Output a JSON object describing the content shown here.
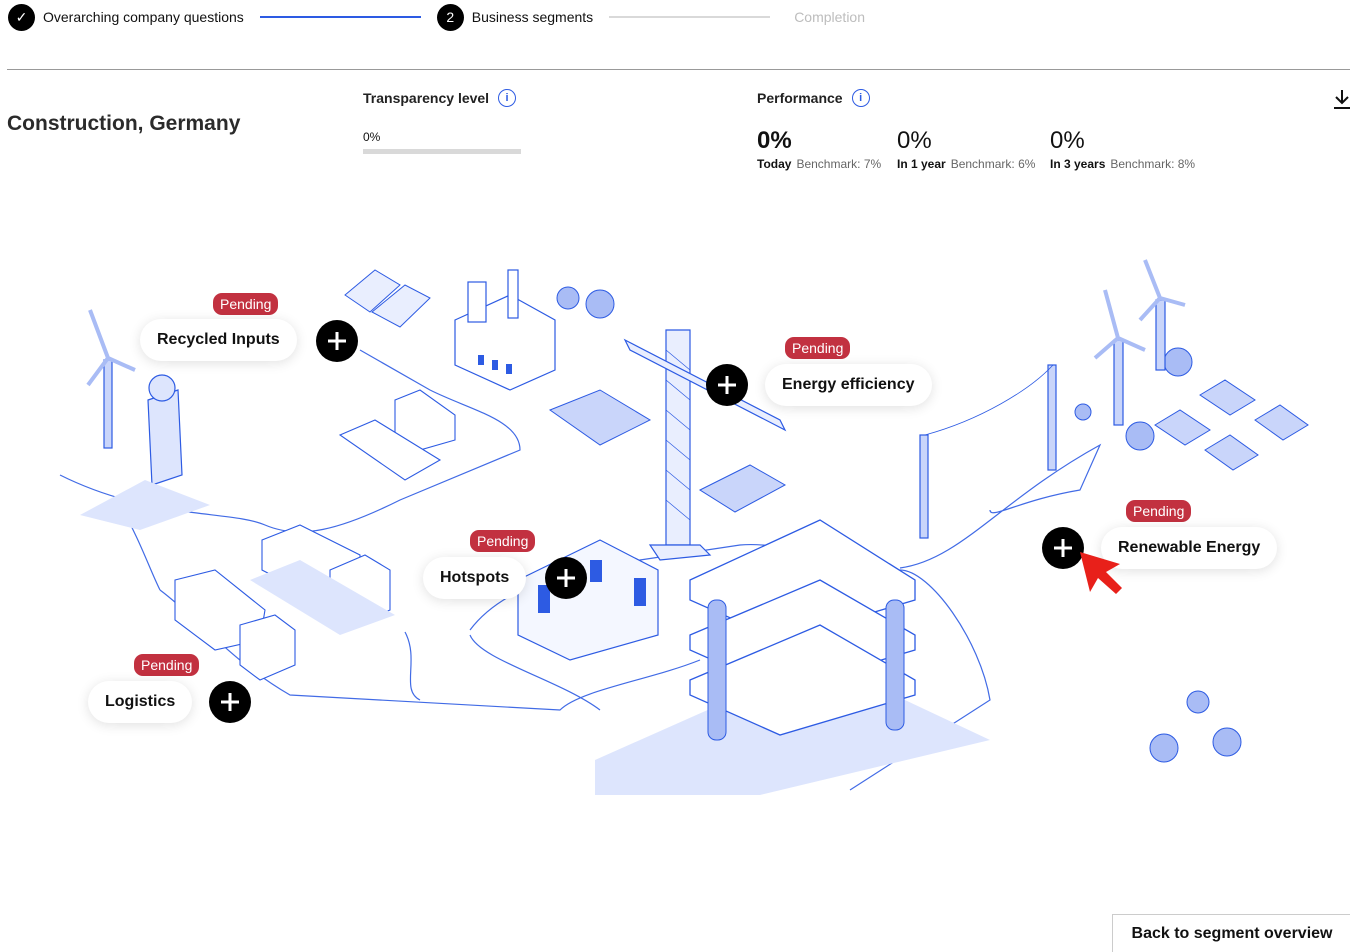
{
  "stepper": {
    "steps": [
      {
        "label": "Overarching company questions",
        "status": "done",
        "marker": "✓"
      },
      {
        "label": "Business segments",
        "status": "active",
        "marker": "2"
      },
      {
        "label": "Completion",
        "status": "todo",
        "marker": ""
      }
    ]
  },
  "page": {
    "title": "Construction, Germany"
  },
  "transparency": {
    "label": "Transparency level",
    "value": "0%",
    "level": 0
  },
  "performance": {
    "label": "Performance",
    "metrics": [
      {
        "value": "0%",
        "period": "Today",
        "benchmark": "Benchmark: 7%"
      },
      {
        "value": "0%",
        "period": "In 1 year",
        "benchmark": "Benchmark: 6%"
      },
      {
        "value": "0%",
        "period": "In 3 years",
        "benchmark": "Benchmark: 8%"
      }
    ]
  },
  "hotspots": {
    "recycled_inputs": {
      "label": "Recycled Inputs",
      "status": "Pending"
    },
    "energy_efficiency": {
      "label": "Energy efficiency",
      "status": "Pending"
    },
    "hotspots": {
      "label": "Hotspots",
      "status": "Pending"
    },
    "renewable_energy": {
      "label": "Renewable Energy",
      "status": "Pending"
    },
    "logistics": {
      "label": "Logistics",
      "status": "Pending"
    }
  },
  "icons": {
    "info": "info-icon",
    "download": "download-icon",
    "plus": "plus-icon",
    "check": "check-icon"
  },
  "colors": {
    "accent": "#2d5be3",
    "pending": "#c23140",
    "illustration": "#a9bcf5"
  },
  "footer": {
    "back_label": "Back to segment overview"
  }
}
